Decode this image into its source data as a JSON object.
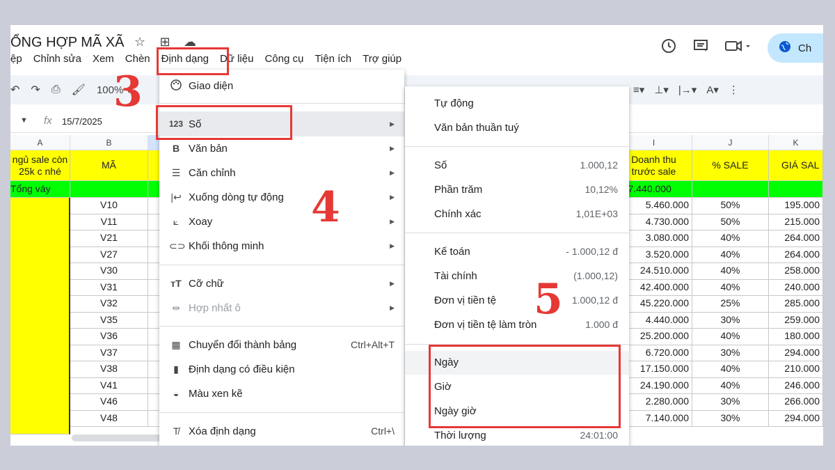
{
  "doc": {
    "title": "ỔNG HỢP MÃ XÃ",
    "icons": [
      "star-icon",
      "move-to-folder-icon",
      "cloud-saved-icon"
    ]
  },
  "menubar": [
    "ệp",
    "Chỉnh sửa",
    "Xem",
    "Chèn",
    "Định dạng",
    "Dữ liệu",
    "Công cụ",
    "Tiện ích",
    "Trợ giúp"
  ],
  "share_label": "Ch",
  "toolbar": {
    "zoom": "100%"
  },
  "formula_bar": {
    "fx": "fx",
    "value": "15/7/2025"
  },
  "sheet": {
    "col_letters": {
      "a": "A",
      "b": "B",
      "i": "I",
      "j": "J",
      "k": "K"
    },
    "header_row": {
      "a": "ngủ sale còn\n25k c nhé",
      "b": "MÃ",
      "i": "Doanh thu\ntrước sale",
      "j": "% SALE",
      "k": "GIÁ SAL"
    },
    "group_row": {
      "a": "Tổng váy",
      "i": "507.440.000"
    },
    "rows": [
      {
        "code": "V10",
        "revenue": "5.460.000",
        "sale": "50%",
        "price": "195.000"
      },
      {
        "code": "V11",
        "revenue": "4.730.000",
        "sale": "50%",
        "price": "215.000"
      },
      {
        "code": "V21",
        "revenue": "3.080.000",
        "sale": "40%",
        "price": "264.000"
      },
      {
        "code": "V27",
        "revenue": "3.520.000",
        "sale": "40%",
        "price": "264.000"
      },
      {
        "code": "V30",
        "revenue": "24.510.000",
        "sale": "40%",
        "price": "258.000"
      },
      {
        "code": "V31",
        "revenue": "42.400.000",
        "sale": "40%",
        "price": "240.000"
      },
      {
        "code": "V32",
        "revenue": "45.220.000",
        "sale": "25%",
        "price": "285.000"
      },
      {
        "code": "V35",
        "revenue": "4.440.000",
        "sale": "30%",
        "price": "259.000"
      },
      {
        "code": "V36",
        "revenue": "25.200.000",
        "sale": "40%",
        "price": "180.000"
      },
      {
        "code": "V37",
        "revenue": "6.720.000",
        "sale": "30%",
        "price": "294.000"
      },
      {
        "code": "V38",
        "revenue": "17.150.000",
        "sale": "40%",
        "price": "210.000"
      },
      {
        "code": "V41",
        "revenue": "24.190.000",
        "sale": "40%",
        "price": "246.000"
      },
      {
        "code": "V46",
        "revenue": "2.280.000",
        "sale": "30%",
        "price": "266.000"
      },
      {
        "code": "V48",
        "revenue": "7.140.000",
        "sale": "30%",
        "price": "294.000"
      }
    ]
  },
  "format_menu": {
    "items": [
      {
        "icon": "palette-icon",
        "label": "Giao diện"
      },
      {
        "icon": "number-format-icon",
        "glyph": "123",
        "label": "Số",
        "submenu": true
      },
      {
        "icon": "bold-icon",
        "glyph": "B",
        "label": "Văn bản",
        "submenu": true
      },
      {
        "icon": "align-icon",
        "label": "Căn chỉnh",
        "submenu": true
      },
      {
        "icon": "wrap-icon",
        "label": "Xuống dòng tự động",
        "submenu": true
      },
      {
        "icon": "rotate-icon",
        "label": "Xoay",
        "submenu": true
      },
      {
        "icon": "smart-chip-icon",
        "label": "Khối thông minh",
        "submenu": true
      },
      {
        "icon": "font-size-icon",
        "glyph": "тT",
        "label": "Cỡ chữ",
        "submenu": true
      },
      {
        "icon": "merge-cells-icon",
        "label": "Hợp nhất ô",
        "submenu": true,
        "disabled": true
      },
      {
        "icon": "table-convert-icon",
        "label": "Chuyển đổi thành bảng",
        "shortcut": "Ctrl+Alt+T"
      },
      {
        "icon": "conditional-format-icon",
        "label": "Định dạng có điều kiện"
      },
      {
        "icon": "alternating-colors-icon",
        "label": "Màu xen kẽ"
      },
      {
        "icon": "clear-format-icon",
        "label": "Xóa định dạng",
        "shortcut": "Ctrl+\\"
      }
    ]
  },
  "number_submenu": {
    "items": [
      {
        "label": "Tự động",
        "example": ""
      },
      {
        "label": "Văn bản thuần tuý",
        "example": ""
      },
      {
        "label": "Số",
        "example": "1.000,12"
      },
      {
        "label": "Phần trăm",
        "example": "10,12%"
      },
      {
        "label": "Chính xác",
        "example": "1,01E+03"
      },
      {
        "label": "Kế toán",
        "example": "- 1.000,12 đ"
      },
      {
        "label": "Tài chính",
        "example": "(1.000,12)"
      },
      {
        "label": "Đơn vị tiền tệ",
        "example": "1.000,12 đ"
      },
      {
        "label": "Đơn vị tiền tệ làm tròn",
        "example": "1.000 đ"
      },
      {
        "label": "Ngày",
        "example": ""
      },
      {
        "label": "Giờ",
        "example": ""
      },
      {
        "label": "Ngày giờ",
        "example": ""
      },
      {
        "label": "Thời lượng",
        "example": "24:01:00"
      }
    ]
  },
  "annotations": {
    "step3": "3",
    "step4": "4",
    "step5": "5"
  },
  "colors": {
    "annotation_red": "#e53935",
    "header_yellow": "#ffff00",
    "group_green": "#00ff00",
    "share_blue": "#c2e7ff"
  }
}
